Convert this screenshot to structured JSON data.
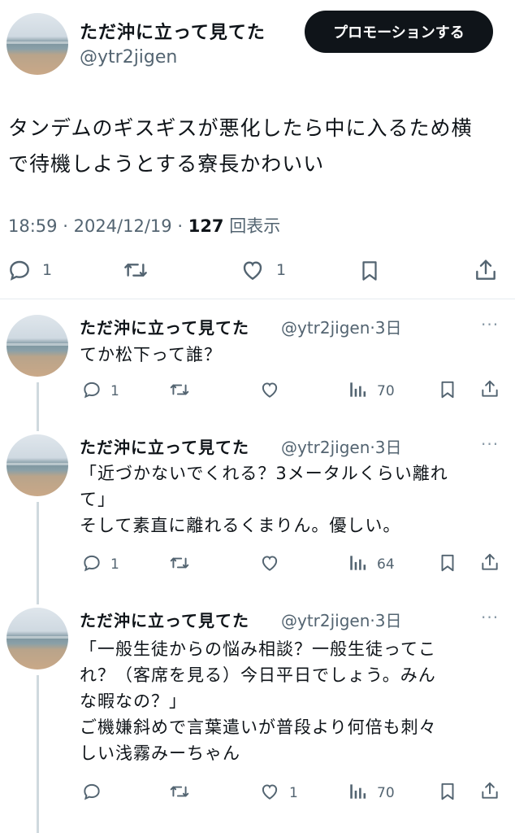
{
  "main_tweet": {
    "display_name": "ただ沖に立って見てた",
    "handle": "@ytr2jigen",
    "promote_label": "プロモーションする",
    "text_line1": "タンデムのギスギスが悪化したら中に入るため横",
    "text_line2": "で待機しようとする寮長かわいい",
    "time": "18:59",
    "separator": "·",
    "date": "2024/12/19",
    "views": "127",
    "views_label": "回表示",
    "reply_count": "1",
    "like_count": "1"
  },
  "replies": [
    {
      "display_name": "ただ沖に立って見てた",
      "handle": "@ytr2jigen",
      "age": "·3日",
      "more": "···",
      "lines": [
        "てか松下って誰？"
      ],
      "reply_count": "1",
      "views": "70"
    },
    {
      "display_name": "ただ沖に立って見てた",
      "handle": "@ytr2jigen",
      "age": "·3日",
      "more": "···",
      "lines": [
        "「近づかないでくれる？3メータルくらい離れ",
        "て」",
        "そして素直に離れるくまりん。優しい。"
      ],
      "reply_count": "1",
      "views": "64"
    },
    {
      "display_name": "ただ沖に立って見てた",
      "handle": "@ytr2jigen",
      "age": "·3日",
      "more": "···",
      "lines": [
        "「一般生徒からの悩み相談？一般生徒ってこ",
        "れ？（客席を見る）今日平日でしょう。みん",
        "な暇なの？」",
        "ご機嫌斜めで言葉遣いが普段より何倍も刺々",
        "しい浅霧みーちゃん"
      ],
      "like_count": "1",
      "views": "70"
    }
  ],
  "colors": {
    "text": "#0f1419",
    "secondary": "#536471",
    "button_bg": "#0f1419",
    "thread_line": "#cfd9de"
  },
  "icons": [
    "reply-icon",
    "retweet-icon",
    "like-icon",
    "bookmark-icon",
    "share-icon",
    "views-icon",
    "more-icon"
  ]
}
